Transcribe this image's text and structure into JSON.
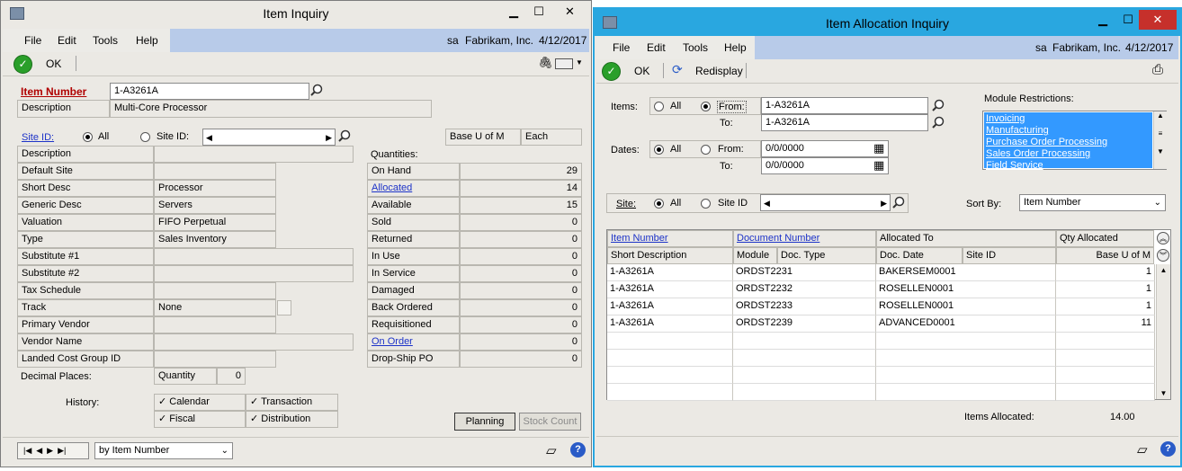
{
  "left": {
    "title": "Item Inquiry",
    "menu": [
      "File",
      "Edit",
      "Tools",
      "Help"
    ],
    "user": "sa",
    "company": "Fabrikam, Inc.",
    "date": "4/12/2017",
    "ok": "OK",
    "item_number_label": "Item Number",
    "item_number": "1-A3261A",
    "description_label": "Description",
    "description": "Multi-Core Processor",
    "site_id_label": "Site ID:",
    "radio_all": "All",
    "radio_site": "Site ID:",
    "base_uom_label": "Base U of M",
    "base_uom": "Each",
    "details": [
      {
        "label": "Description",
        "value": ""
      },
      {
        "label": "Default Site",
        "value": ""
      },
      {
        "label": "Short Desc",
        "value": "Processor"
      },
      {
        "label": "Generic Desc",
        "value": "Servers"
      },
      {
        "label": "Valuation",
        "value": "FIFO Perpetual"
      },
      {
        "label": "Type",
        "value": "Sales Inventory"
      },
      {
        "label": "Substitute #1",
        "value": ""
      },
      {
        "label": "Substitute #2",
        "value": ""
      },
      {
        "label": "Tax Schedule",
        "value": ""
      },
      {
        "label": "Track",
        "value": "None"
      },
      {
        "label": "Primary Vendor",
        "value": ""
      },
      {
        "label": "Vendor Name",
        "value": ""
      },
      {
        "label": "Landed Cost Group ID",
        "value": ""
      }
    ],
    "decimal_places_label": "Decimal Places:",
    "quantity_label": "Quantity",
    "quantity_decimals": "0",
    "quantities_label": "Quantities:",
    "quantities": [
      {
        "label": "On Hand",
        "value": "29",
        "link": false
      },
      {
        "label": "Allocated",
        "value": "14",
        "link": true
      },
      {
        "label": "Available",
        "value": "15",
        "link": false
      },
      {
        "label": "Sold",
        "value": "0",
        "link": false
      },
      {
        "label": "Returned",
        "value": "0",
        "link": false
      },
      {
        "label": "In Use",
        "value": "0",
        "link": false
      },
      {
        "label": "In Service",
        "value": "0",
        "link": false
      },
      {
        "label": "Damaged",
        "value": "0",
        "link": false
      },
      {
        "label": "Back Ordered",
        "value": "0",
        "link": false
      },
      {
        "label": "Requisitioned",
        "value": "0",
        "link": false
      },
      {
        "label": "On Order",
        "value": "0",
        "link": true
      },
      {
        "label": "Drop-Ship PO",
        "value": "0",
        "link": false
      }
    ],
    "history_label": "History:",
    "history": [
      "Calendar",
      "Transaction",
      "Fiscal",
      "Distribution"
    ],
    "planning": "Planning",
    "stock_count": "Stock Count",
    "sort": "by Item Number"
  },
  "right": {
    "title": "Item Allocation Inquiry",
    "menu": [
      "File",
      "Edit",
      "Tools",
      "Help"
    ],
    "user": "sa",
    "company": "Fabrikam, Inc.",
    "date": "4/12/2017",
    "ok": "OK",
    "redisplay": "Redisplay",
    "items_label": "Items:",
    "all": "All",
    "from": "From:",
    "to": "To:",
    "items_from": "1-A3261A",
    "items_to": "1-A3261A",
    "dates_label": "Dates:",
    "dates_from": "0/0/0000",
    "dates_to": "0/0/0000",
    "module_label": "Module Restrictions:",
    "modules": [
      "Invoicing",
      "Manufacturing",
      "Purchase Order Processing",
      "Sales Order Processing",
      "Field Service"
    ],
    "site_label": "Site:",
    "site_id": "Site ID",
    "sort_by_label": "Sort By:",
    "sort_by": "Item Number",
    "headers1": [
      "Item Number",
      "Document Number",
      "Allocated To",
      "Qty Allocated"
    ],
    "headers2": [
      "Short Description",
      "Module",
      "Doc. Type",
      "Doc. Date",
      "Site ID",
      "Base U of M"
    ],
    "rows": [
      {
        "desc": "1-A3261A",
        "doc": "ORDST2231",
        "to": "BAKERSEM0001",
        "qty": "1"
      },
      {
        "desc": "1-A3261A",
        "doc": "ORDST2232",
        "to": "ROSELLEN0001",
        "qty": "1"
      },
      {
        "desc": "1-A3261A",
        "doc": "ORDST2233",
        "to": "ROSELLEN0001",
        "qty": "1"
      },
      {
        "desc": "1-A3261A",
        "doc": "ORDST2239",
        "to": "ADVANCED0001",
        "qty": "11"
      }
    ],
    "items_allocated_label": "Items Allocated:",
    "items_allocated": "14.00"
  }
}
